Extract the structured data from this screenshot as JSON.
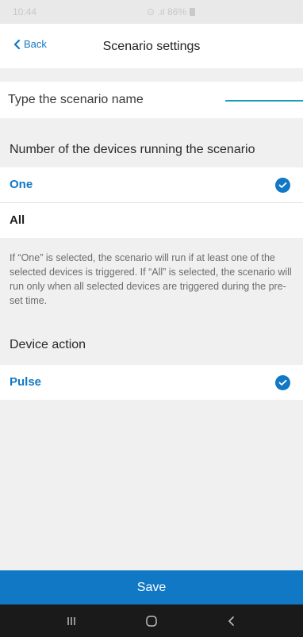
{
  "status_bar": {
    "time": "10:44",
    "signal_text": "⊙ .ıl 86%"
  },
  "nav": {
    "back_label": "Back",
    "title": "Scenario settings"
  },
  "name_field": {
    "placeholder": "Type the scenario name",
    "value": ""
  },
  "devices_section": {
    "header": "Number of the devices running the scenario",
    "options": [
      {
        "label": "One",
        "selected": true
      },
      {
        "label": "All",
        "selected": false
      }
    ],
    "help_text": "If “One” is selected, the scenario will run if at least one of the selected devices is triggered. If “All” is selected, the scenario will run only when all selected devices are triggered during the pre-set time."
  },
  "action_section": {
    "header": "Device action",
    "options": [
      {
        "label": "Pulse",
        "selected": true
      }
    ]
  },
  "save_label": "Save",
  "colors": {
    "accent": "#1178c5",
    "background": "#f0f0f0",
    "underline": "#1aa0b4"
  },
  "icons": {
    "back": "chevron-left-icon",
    "check": "check-circle-icon",
    "recents": "recents-icon",
    "home": "home-icon",
    "back_nav": "back-icon"
  }
}
